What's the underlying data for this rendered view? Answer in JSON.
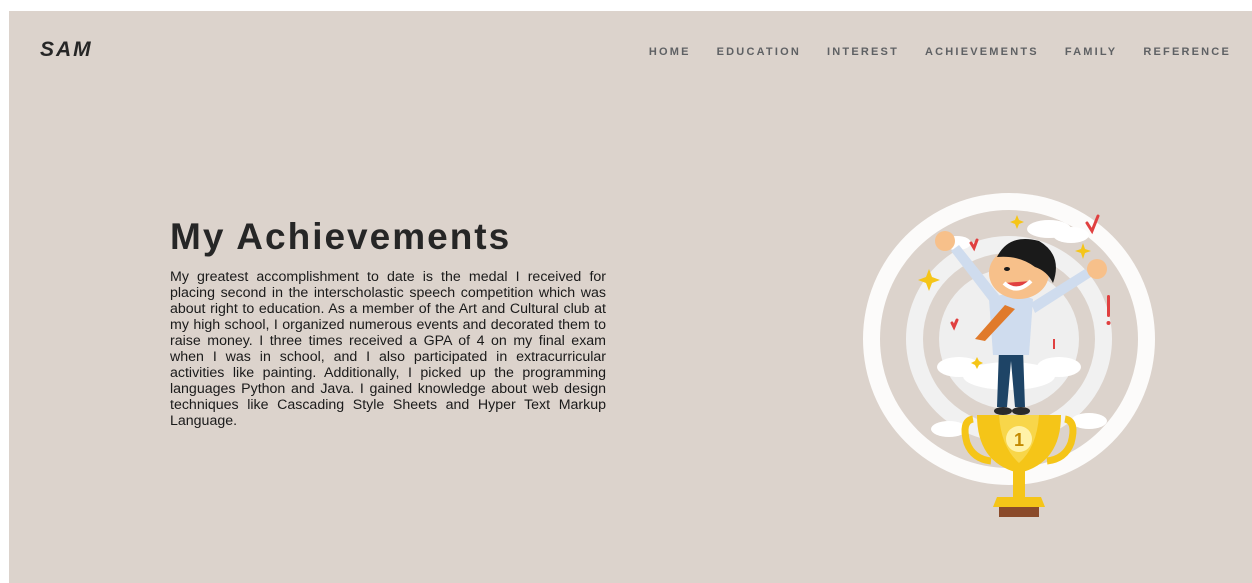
{
  "header": {
    "logo": "SAM",
    "nav": [
      {
        "label": "HOME"
      },
      {
        "label": "EDUCATION"
      },
      {
        "label": "INTEREST"
      },
      {
        "label": "ACHIEVEMENTS"
      },
      {
        "label": "FAMILY"
      },
      {
        "label": "REFERENCE"
      }
    ]
  },
  "main": {
    "title": "My Achievements",
    "paragraph": "My greatest accomplishment to date is the medal I received for placing second in the interscholastic speech competition which was about right to education. As a member of the Art and Cultural club at my high school, I organized numerous events and decorated them to raise money. I three times received a GPA of 4 on my final exam when I was in school, and I also participated in extracurricular activities like painting. Additionally, I picked up the programming languages Python and Java. I gained knowledge about web design techniques like Cascading Style Sheets and Hyper Text Markup Language."
  },
  "illustration": {
    "trophy_number": "1"
  },
  "colors": {
    "background": "#dcd3cc",
    "text_dark": "#262626",
    "nav_text": "#5f6164",
    "trophy_gold": "#f5c518",
    "tie_orange": "#e07a2b",
    "accent_red": "#e04040"
  }
}
